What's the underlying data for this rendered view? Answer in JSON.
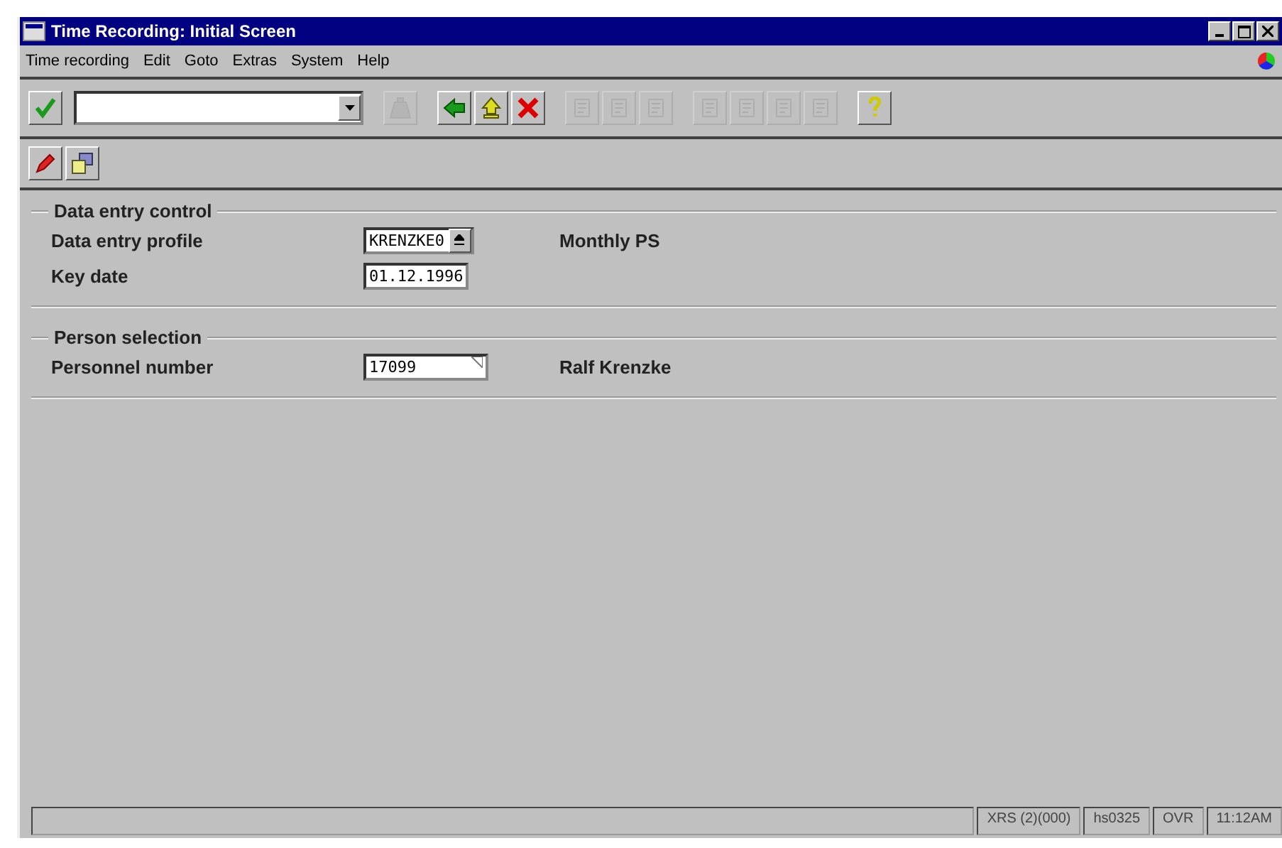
{
  "window": {
    "title": "Time Recording: Initial Screen"
  },
  "menu": [
    "Time recording",
    "Edit",
    "Goto",
    "Extras",
    "System",
    "Help"
  ],
  "toolbar": [
    {
      "kind": "enter",
      "disabled": false
    },
    {
      "kind": "command"
    },
    {
      "kind": "save",
      "disabled": true
    },
    {
      "kind": "back",
      "disabled": false
    },
    {
      "kind": "exit",
      "disabled": false
    },
    {
      "kind": "cancel",
      "disabled": false
    },
    {
      "kind": "print",
      "disabled": true
    },
    {
      "kind": "find",
      "disabled": true
    },
    {
      "kind": "findnext",
      "disabled": true
    },
    {
      "kind": "first",
      "disabled": true
    },
    {
      "kind": "prev",
      "disabled": true
    },
    {
      "kind": "next",
      "disabled": true
    },
    {
      "kind": "last",
      "disabled": true
    },
    {
      "kind": "help",
      "disabled": false
    }
  ],
  "app_toolbar": [
    {
      "kind": "edit"
    },
    {
      "kind": "overview"
    }
  ],
  "groups": [
    {
      "title": "Data entry control",
      "fields": [
        {
          "label": "Data entry profile",
          "value": "KRENZKE0",
          "kind": "dropdown",
          "note": "Monthly PS"
        },
        {
          "label": "Key date",
          "value": "01.12.1996",
          "kind": "text"
        }
      ]
    },
    {
      "title": "Person selection",
      "fields": [
        {
          "label": "Personnel number",
          "value": "17099",
          "kind": "required",
          "note": "Ralf Krenzke"
        }
      ]
    }
  ],
  "status_bar": [
    "XRS (2)(000)",
    "hs0325",
    "OVR",
    "11:12AM"
  ]
}
